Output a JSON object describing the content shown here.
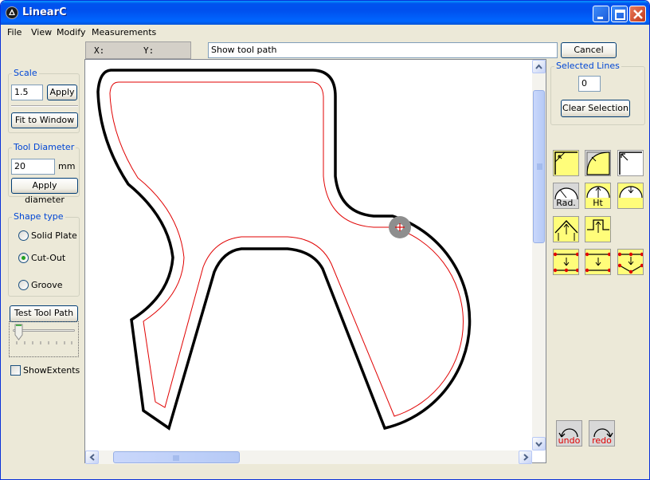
{
  "window": {
    "title": "LinearC"
  },
  "menu": [
    "File",
    "View",
    "Modify",
    "Measurements"
  ],
  "coords": {
    "x_label": "X:",
    "y_label": "Y:"
  },
  "status_field": {
    "value": "Show tool path"
  },
  "cancel_label": "Cancel",
  "scale": {
    "legend": "Scale",
    "value": "1.5",
    "apply_label": "Apply",
    "fit_label": "Fit to Window"
  },
  "tool_diameter": {
    "legend": "Tool Diameter",
    "value": "20",
    "unit": "mm",
    "apply_label": "Apply diameter"
  },
  "shape_type": {
    "legend": "Shape type",
    "options": [
      "Solid Plate",
      "Cut-Out",
      "Groove"
    ],
    "selected": "Cut-Out"
  },
  "test_tool_path_label": "Test Tool Path",
  "slider": {
    "value": 0
  },
  "show_extents": {
    "label": "ShowExtents",
    "checked": false
  },
  "selected_lines": {
    "legend": "Selected Lines",
    "value": "0",
    "clear_label": "Clear Selection"
  },
  "tools": {
    "radius_label": "Rad.",
    "height_label": "Ht",
    "undo_label": "undo",
    "redo_label": "redo"
  },
  "colors": {
    "shape_outline": "#000000",
    "tool_path": "#e00000",
    "accent": "#0046d5",
    "tool_highlight": "#fffd7a",
    "marker_dot": "#e00000"
  }
}
